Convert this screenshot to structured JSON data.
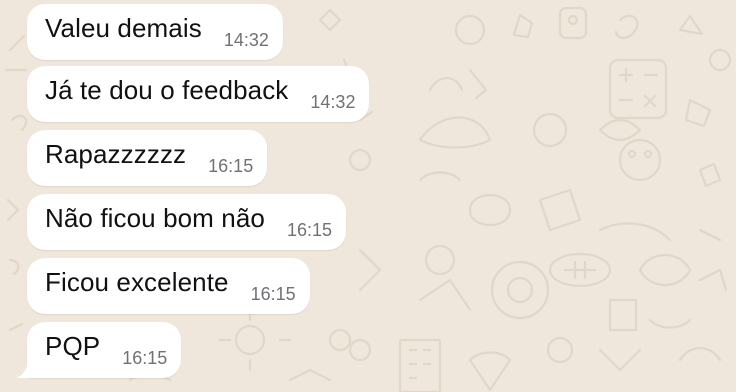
{
  "messages": [
    {
      "text": "Valeu demais",
      "time": "14:32"
    },
    {
      "text": "Já te dou o feedback",
      "time": "14:32"
    },
    {
      "text": "Rapazzzzzz",
      "time": "16:15"
    },
    {
      "text": "Não ficou bom não",
      "time": "16:15"
    },
    {
      "text": "Ficou excelente",
      "time": "16:15"
    },
    {
      "text": "PQP",
      "time": "16:15"
    }
  ],
  "colors": {
    "background": "#efe7dc",
    "bubble": "#ffffff",
    "text": "#111111",
    "timestamp": "#6f7174",
    "doodle": "#e3d9cc"
  }
}
